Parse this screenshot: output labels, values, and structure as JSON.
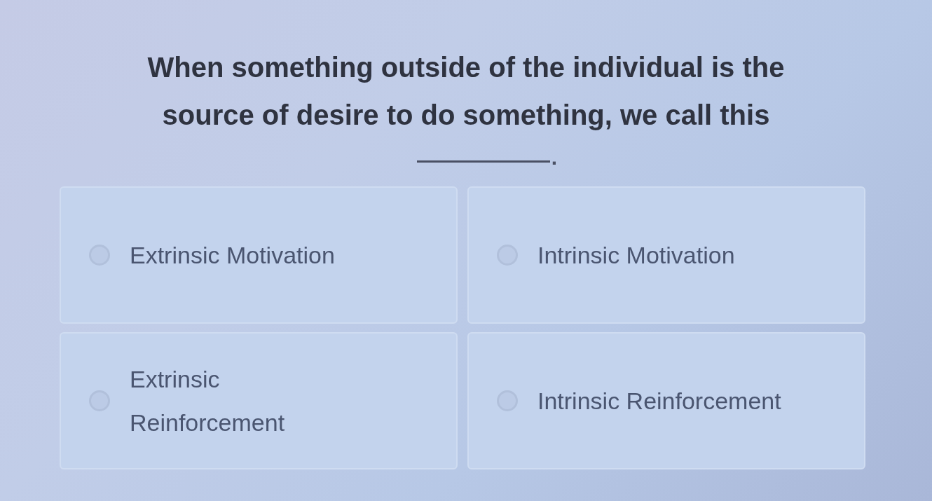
{
  "question": {
    "text": "When something outside of the individual is the source of desire to do something, we call this",
    "after_blank": "."
  },
  "options": [
    {
      "label": "Extrinsic Motivation",
      "selected": false
    },
    {
      "label": "Intrinsic Motivation",
      "selected": false
    },
    {
      "label": "Extrinsic Reinforcement",
      "selected": false
    },
    {
      "label": "Intrinsic Reinforcement",
      "selected": false
    }
  ]
}
